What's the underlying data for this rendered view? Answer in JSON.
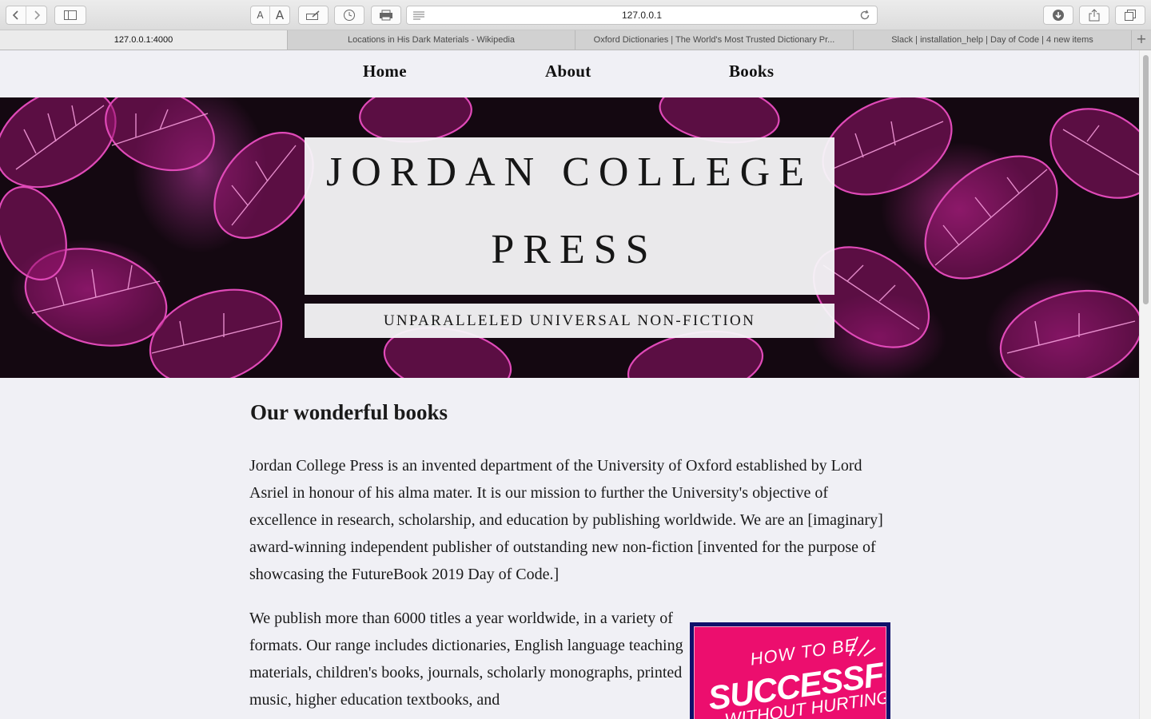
{
  "browser": {
    "url": "127.0.0.1",
    "font_smaller": "A",
    "font_larger": "A",
    "tabs": [
      {
        "title": "127.0.0.1:4000",
        "active": true
      },
      {
        "title": "Locations in His Dark Materials - Wikipedia",
        "active": false
      },
      {
        "title": "Oxford Dictionaries | The World's Most Trusted Dictionary Pr...",
        "active": false
      },
      {
        "title": "Slack | installation_help | Day of Code | 4 new items",
        "active": false
      }
    ],
    "new_tab_label": "+"
  },
  "nav": {
    "home": "Home",
    "about": "About",
    "books": "Books"
  },
  "hero": {
    "title_line1": "JORDAN COLLEGE",
    "title_line2": "PRESS",
    "subtitle": "UNPARALLELED UNIVERSAL NON-FICTION"
  },
  "main": {
    "heading": "Our wonderful books",
    "paragraph1": "Jordan College Press is an invented department of the University of Oxford established by Lord Asriel in honour of his alma mater. It is our mission to further the University's objective of excellence in research, scholarship, and education by publishing worldwide. We are an [imaginary] award-winning independent publisher of outstanding new non-fiction [invented for the purpose of showcasing the FutureBook 2019 Day of Code.]",
    "paragraph2": "We publish more than 6000 titles a year worldwide, in a variety of formats. Our range includes dictionaries, English language teaching materials, children's books, journals, scholarly monographs, printed music, higher education textbooks, and",
    "book_cover": {
      "line1": "HOW TO BE",
      "line2": "SUCCESSFUL",
      "line3": "WITHOUT HURTING"
    }
  },
  "colors": {
    "page_bg": "#f0f0f5",
    "hero_dark": "#140811",
    "leaf_pink": "#e04ab8",
    "book_pink": "#ec0e6e",
    "book_border": "#10106a"
  }
}
